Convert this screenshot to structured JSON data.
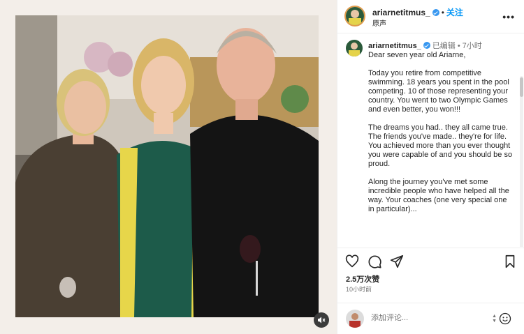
{
  "post": {
    "photo_icon": "photo-of-three-people"
  },
  "header": {
    "username": "ariarnetitmus_",
    "separator": "•",
    "follow_label": "关注",
    "subtitle": "原声",
    "more_label": "•••"
  },
  "caption": {
    "username": "ariarnetitmus_",
    "edited": "已编辑",
    "separator": "•",
    "time": "7小时",
    "paragraphs": [
      "Dear seven year old Ariarne,",
      "Today you retire from competitive swimming. 18 years you spent in the pool competing. 10 of those representing your country. You went to two Olympic Games and even better, you won!!!",
      "The dreams you had.. they all came true. The friends you've made.. they're for life. You achieved more than you ever thought you were capable of and you should be so proud.",
      "Along the journey you've met some incredible people who have helped all the way. Your coaches (one very special one in particular)..."
    ]
  },
  "stats": {
    "likes": "2.5万次赞",
    "posted": "10小时前"
  },
  "comment": {
    "placeholder": "添加评论..."
  },
  "colors": {
    "accent": "#0095f6",
    "verified": "#3797f0",
    "story_ring": "#e09b4b"
  }
}
